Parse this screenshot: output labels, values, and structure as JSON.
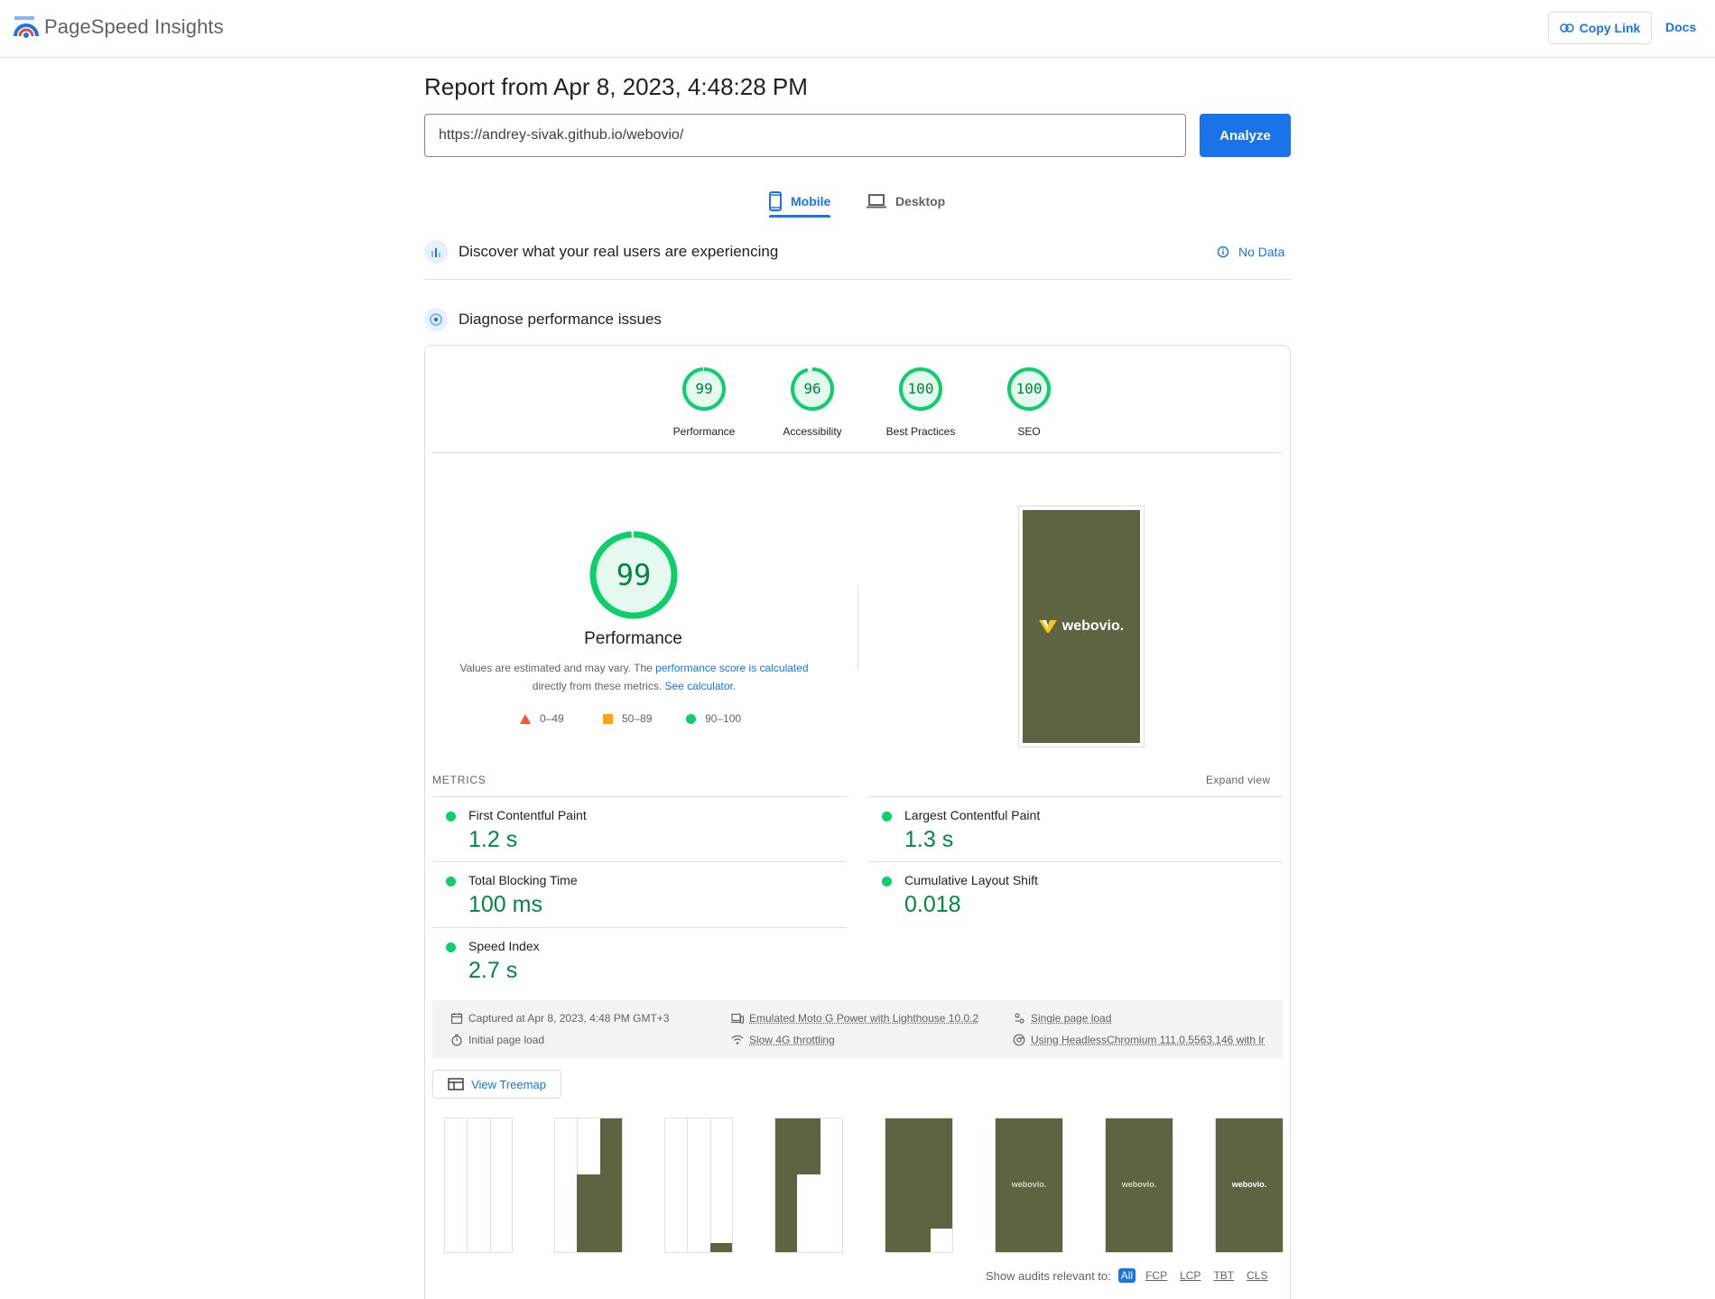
{
  "header": {
    "app_title": "PageSpeed Insights",
    "copy_link_label": "Copy Link",
    "docs_label": "Docs"
  },
  "report": {
    "title": "Report from Apr 8, 2023, 4:48:28 PM",
    "url_value": "https://andrey-sivak.github.io/webovio/",
    "analyze_label": "Analyze"
  },
  "tabs": [
    {
      "label": "Mobile",
      "active": true
    },
    {
      "label": "Desktop",
      "active": false
    }
  ],
  "discover": {
    "title": "Discover what your real users are experiencing",
    "no_data_label": "No Data"
  },
  "diagnose": {
    "title": "Diagnose performance issues"
  },
  "categories": [
    {
      "label": "Performance",
      "score": "99",
      "fraction": 0.99
    },
    {
      "label": "Accessibility",
      "score": "96",
      "fraction": 0.96
    },
    {
      "label": "Best Practices",
      "score": "100",
      "fraction": 1.0
    },
    {
      "label": "SEO",
      "score": "100",
      "fraction": 1.0
    }
  ],
  "performance": {
    "score": "99",
    "fraction": 0.99,
    "title": "Performance",
    "desc_1": "Values are estimated and may vary. The ",
    "desc_link_1": "performance score is calculated",
    "desc_2": "directly from these metrics. ",
    "desc_link_2": "See calculator.",
    "legend": [
      {
        "range": "0–49",
        "color": "#ff4e42"
      },
      {
        "range": "50–89",
        "color": "#ffa400"
      },
      {
        "range": "90–100",
        "color": "#0cce6b"
      }
    ]
  },
  "screenshot_brand": "webovio.",
  "metrics": {
    "heading": "METRICS",
    "expand_label": "Expand view",
    "fcp": {
      "name": "First Contentful Paint",
      "value": "1.2 s"
    },
    "lcp": {
      "name": "Largest Contentful Paint",
      "value": "1.3 s"
    },
    "tbt": {
      "name": "Total Blocking Time",
      "value": "100 ms"
    },
    "cls": {
      "name": "Cumulative Layout Shift",
      "value": "0.018"
    },
    "si": {
      "name": "Speed Index",
      "value": "2.7 s"
    }
  },
  "run_info": {
    "captured": "Captured at Apr 8, 2023, 4:48 PM GMT+3",
    "initial_load": "Initial page load",
    "emulated": "Emulated Moto G Power with Lighthouse 10.0.2",
    "throttling": "Slow 4G throttling",
    "single_load": "Single page load",
    "browser": "Using HeadlessChromium 111.0.5563.146 with lr"
  },
  "treemap_label": "View Treemap",
  "filmstrip_brand": "webovio.",
  "audits_filter": {
    "label": "Show audits relevant to:",
    "chips": [
      "All",
      "FCP",
      "LCP",
      "TBT",
      "CLS"
    ]
  },
  "colors": {
    "accent": "#1a73e8",
    "pass": "#0cce6b",
    "pass_text": "#018642",
    "brand_olive": "#5e6442"
  }
}
